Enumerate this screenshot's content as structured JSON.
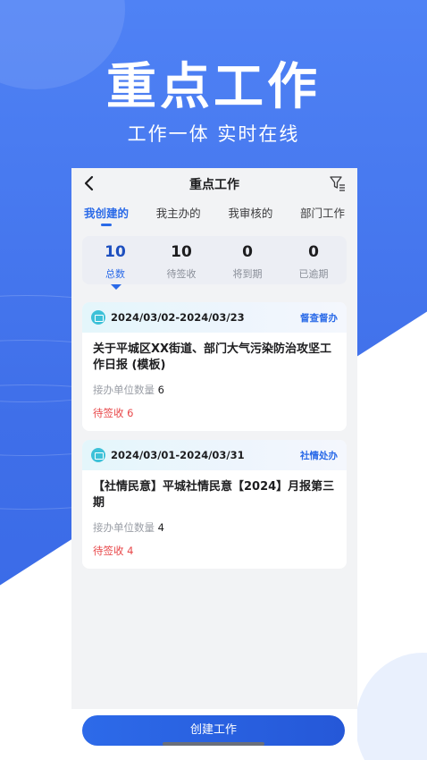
{
  "hero": {
    "title": "重点工作",
    "subtitle": "工作一体 实时在线"
  },
  "nav": {
    "title": "重点工作",
    "back_icon": "chevron-left-icon",
    "filter_icon": "filter-icon"
  },
  "tabs": [
    {
      "label": "我创建的",
      "active": true
    },
    {
      "label": "我主办的",
      "active": false
    },
    {
      "label": "我审核的",
      "active": false
    },
    {
      "label": "部门工作",
      "active": false
    }
  ],
  "stats": [
    {
      "value": "10",
      "label": "总数",
      "active": true
    },
    {
      "value": "10",
      "label": "待签收",
      "active": false
    },
    {
      "value": "0",
      "label": "将到期",
      "active": false
    },
    {
      "value": "0",
      "label": "已逾期",
      "active": false
    }
  ],
  "cards": [
    {
      "date_range": "2024/03/02-2024/03/23",
      "tag": "督查督办",
      "title": "关于平城区XX街道、部门大气污染防治攻坚工作日报 (模板)",
      "meta_label": "接办单位数量",
      "meta_value": "6",
      "status": "待签收 6"
    },
    {
      "date_range": "2024/03/01-2024/03/31",
      "tag": "社情处办",
      "title": "【社情民意】平城社情民意【2024】月报第三期",
      "meta_label": "接办单位数量",
      "meta_value": "4",
      "status": "待签收 4"
    }
  ],
  "create_button": {
    "label": "创建工作"
  },
  "colors": {
    "brand_blue": "#2a6ae8",
    "hero_blue": "#4f82f5",
    "status_red": "#e8484a",
    "tag_icon": "#3dc1d8"
  }
}
